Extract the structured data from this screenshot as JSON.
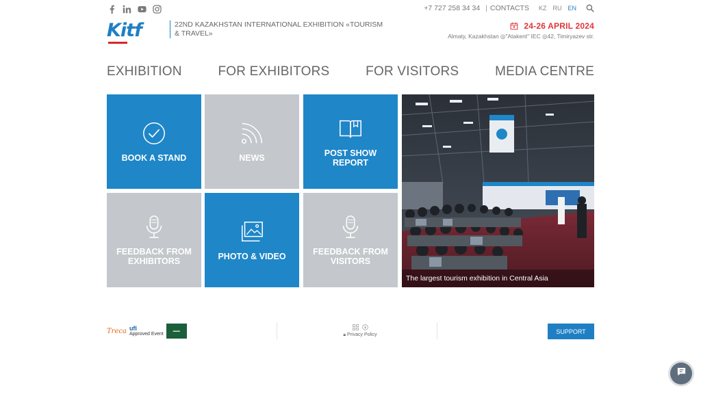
{
  "social": [
    {
      "name": "facebook-icon"
    },
    {
      "name": "linkedin-icon"
    },
    {
      "name": "youtube-icon"
    },
    {
      "name": "instagram-icon"
    }
  ],
  "topbar": {
    "phone": "+7 727 258 34 34",
    "separator": "|",
    "contacts": "CONTACTS",
    "languages": [
      "KZ",
      "RU",
      "EN"
    ],
    "active_language": "EN"
  },
  "brand": {
    "logo_text": "Kitf",
    "tagline": "22ND KAZAKHSTAN INTERNATIONAL EXHIBITION «TOURISM & TRAVEL»"
  },
  "event": {
    "date": "24-26 APRIL 2024",
    "location": "Almaty, Kazakhstan ◎\"Atakent\" IEC ◎42, Timiryazev str."
  },
  "nav": [
    "EXHIBITION",
    "FOR EXHIBITORS",
    "FOR VISITORS",
    "MEDIA CENTRE"
  ],
  "tiles": [
    {
      "label": "BOOK A STAND",
      "icon": "checkmark-circle-icon"
    },
    {
      "label": "NEWS",
      "icon": "rss-icon"
    },
    {
      "label": "POST SHOW REPORT",
      "icon": "open-book-icon"
    },
    {
      "label": "FEEDBACK FROM EXHIBITORS",
      "icon": "microphone-icon"
    },
    {
      "label": "PHOTO & VIDEO",
      "icon": "images-icon"
    },
    {
      "label": "FEEDBACK FROM VISITORS",
      "icon": "microphone-icon"
    }
  ],
  "photo": {
    "caption": "The largest tourism exhibition in Central Asia"
  },
  "footer": {
    "partner_treca": "Treca",
    "partner_ufi": "ufi",
    "partner_ufi_sub": "Approved Event",
    "privacy": "Privacy Policy",
    "support": "SUPPORT"
  },
  "colors": {
    "accent_blue": "#1f86c8",
    "tile_grey": "#c4c7cb",
    "date_red": "#e0353a"
  }
}
